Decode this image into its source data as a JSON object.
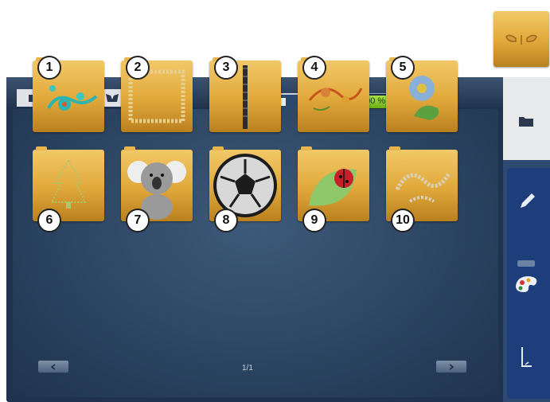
{
  "top_preview": {
    "icon": "butterfly-design-folder-icon"
  },
  "breadcrumb": [
    {
      "icon": "folder-icon"
    },
    {
      "icon": "machine-folder-icon"
    },
    {
      "icon": "butterfly-designs-icon"
    }
  ],
  "view_toggle": {
    "left_icon": "machine-storage-icon",
    "right_icon": "usb-stick-icon"
  },
  "memory": {
    "label": "100 %",
    "fill_percent": 100,
    "color": "#7ec21e"
  },
  "designs": [
    {
      "number": "1",
      "icon": "teal-floral-design-icon"
    },
    {
      "number": "2",
      "icon": "lace-frame-design-icon"
    },
    {
      "number": "3",
      "icon": "border-stripe-design-icon"
    },
    {
      "number": "4",
      "icon": "red-floral-design-icon"
    },
    {
      "number": "5",
      "icon": "blue-flower-design-icon"
    },
    {
      "number": "6",
      "icon": "christmas-tree-design-icon"
    },
    {
      "number": "7",
      "icon": "koala-design-icon"
    },
    {
      "number": "8",
      "icon": "soccer-ball-design-icon"
    },
    {
      "number": "9",
      "icon": "ladybug-leaf-design-icon"
    },
    {
      "number": "10",
      "icon": "lace-swirl-design-icon"
    }
  ],
  "pagination": {
    "label": "1/1"
  },
  "side_tabs": [
    {
      "icon": "folder-icon"
    },
    {
      "icon": "pencil-icon"
    },
    {
      "icon": "palette-icon"
    },
    {
      "icon": "needle-icon"
    }
  ]
}
